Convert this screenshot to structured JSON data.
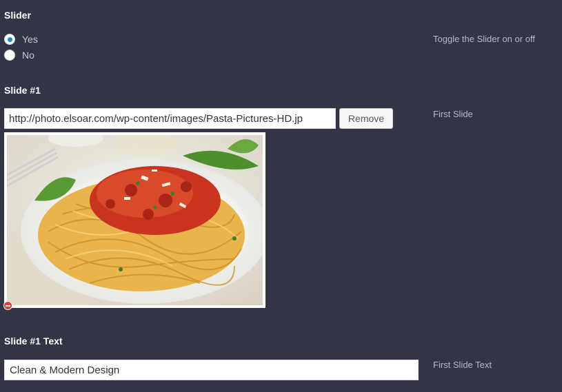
{
  "slider": {
    "title": "Slider",
    "help": "Toggle the Slider on or off",
    "options": [
      {
        "label": "Yes",
        "checked": true
      },
      {
        "label": "No",
        "checked": false
      }
    ]
  },
  "slide1": {
    "title": "Slide #1",
    "url_value": "http://photo.elsoar.com/wp-content/images/Pasta-Pictures-HD.jp",
    "remove_label": "Remove",
    "help": "First Slide",
    "image_subject": "pasta-photo"
  },
  "slide1_text": {
    "title": "Slide #1 Text",
    "value": "Clean & Modern Design",
    "help": "First Slide Text"
  },
  "colors": {
    "background": "#333547",
    "radio_accent": "#1e8cbe",
    "remove_icon": "#d9413a"
  }
}
